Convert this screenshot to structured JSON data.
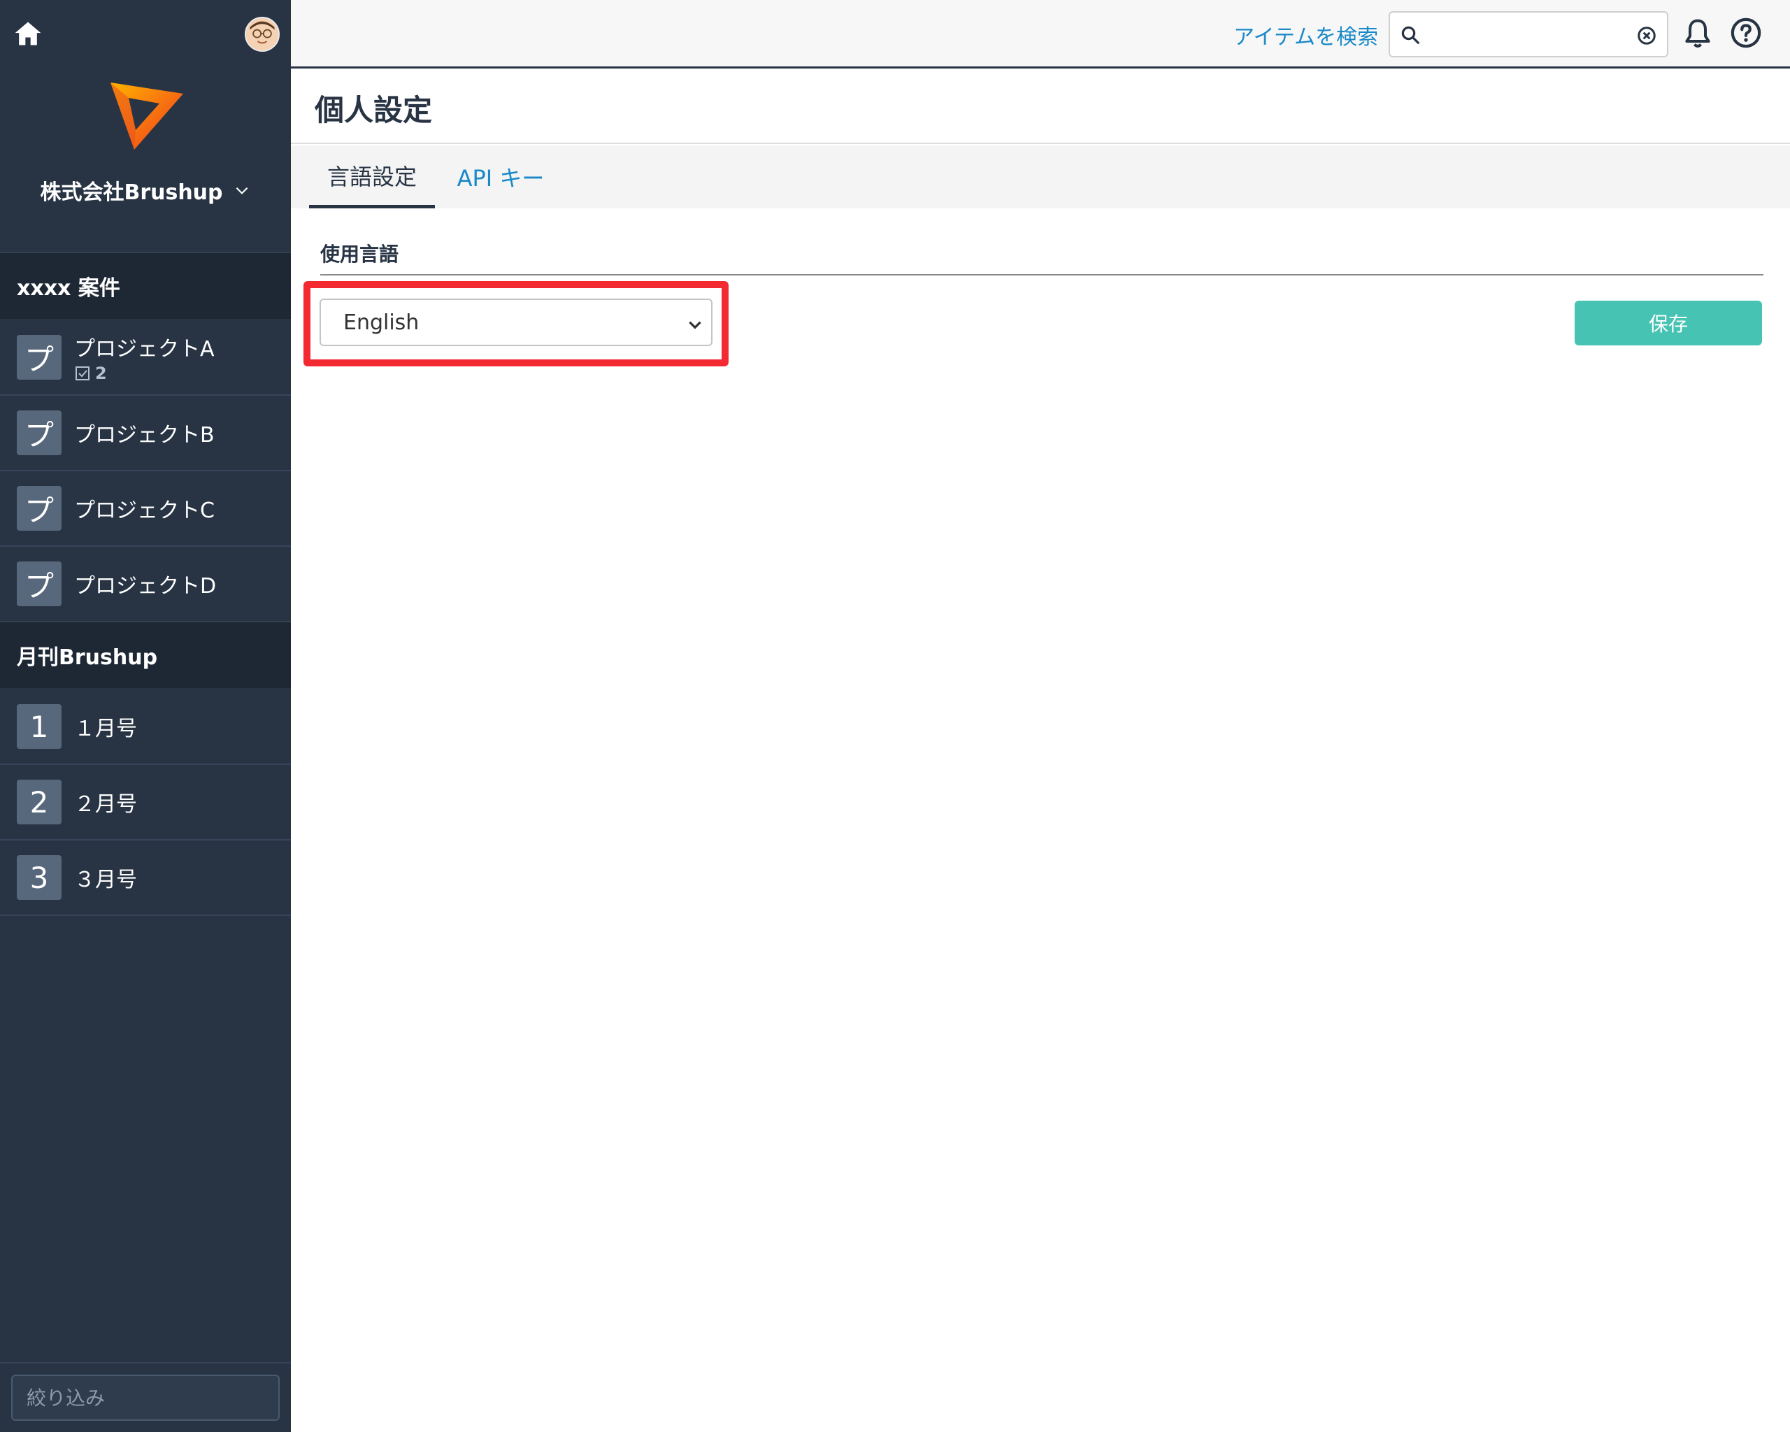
{
  "sidebar": {
    "org_name": "株式会社Brushup",
    "sections": [
      {
        "title": "xxxx 案件",
        "items": [
          {
            "badge": "プ",
            "label": "プロジェクトA",
            "sub_count": "2"
          },
          {
            "badge": "プ",
            "label": "プロジェクトB"
          },
          {
            "badge": "プ",
            "label": "プロジェクトC"
          },
          {
            "badge": "プ",
            "label": "プロジェクトD"
          }
        ]
      },
      {
        "title": "月刊Brushup",
        "items": [
          {
            "badge": "1",
            "label": "１月号"
          },
          {
            "badge": "2",
            "label": "２月号"
          },
          {
            "badge": "3",
            "label": "３月号"
          }
        ]
      }
    ],
    "filter_placeholder": "絞り込み"
  },
  "topbar": {
    "search_link": "アイテムを検索",
    "search_value": ""
  },
  "page": {
    "title": "個人設定",
    "tabs": [
      {
        "label": "言語設定",
        "active": true
      },
      {
        "label": "API キー",
        "active": false
      }
    ],
    "field_label": "使用言語",
    "language_selected": "English",
    "save_label": "保存"
  },
  "colors": {
    "sidebar_bg": "#283444",
    "link": "#1a89c8",
    "save_button": "#46c3b3",
    "highlight": "#f42a33"
  }
}
